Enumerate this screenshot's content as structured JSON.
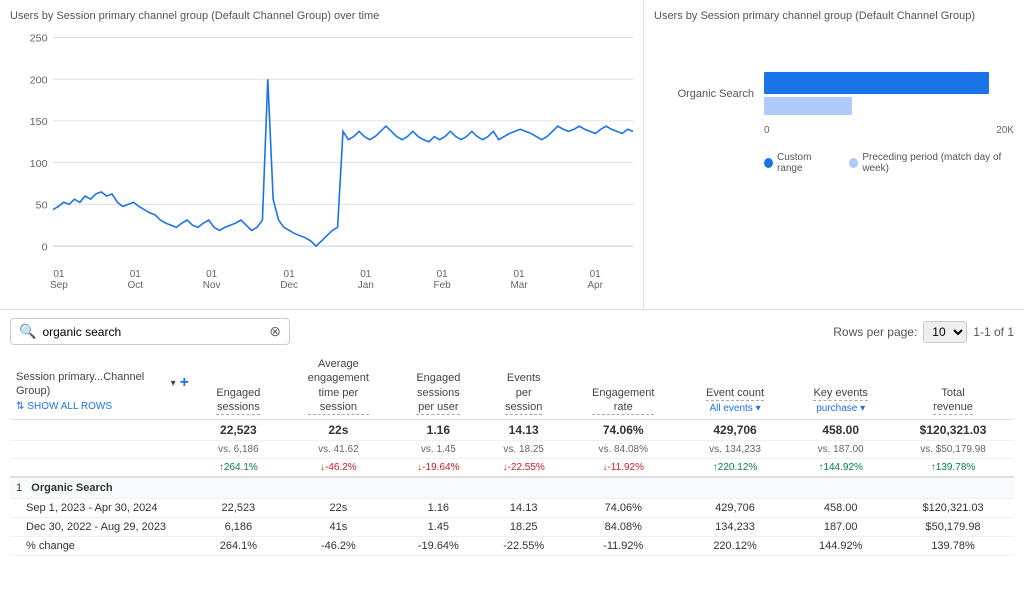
{
  "leftChart": {
    "title": "Users by Session primary channel group (Default Channel Group) over time",
    "xLabels": [
      "01\nSep",
      "01\nOct",
      "01\nNov",
      "01\nDec",
      "01\nJan",
      "01\nFeb",
      "01\nMar",
      "01\nApr"
    ],
    "yLabels": [
      "250",
      "200",
      "150",
      "100",
      "50",
      "0"
    ]
  },
  "rightChart": {
    "title": "Users by Session primary channel group (Default Channel Group)",
    "barLabel": "Organic Search",
    "xAxisMax": "20K",
    "xAxisStart": "0",
    "legend": {
      "custom": "Custom range",
      "preceding": "Preceding period (match day of week)"
    }
  },
  "search": {
    "placeholder": "organic search",
    "value": "organic search"
  },
  "pagination": {
    "rowsLabel": "Rows per page:",
    "rowsValue": "10",
    "range": "1-1 of 1"
  },
  "table": {
    "col1": "Session primary...Channel Group)",
    "col2": "Engaged\nsessions",
    "col3": "Average\nengagement\ntime per\nsession",
    "col4": "Engaged\nsessions\nper user",
    "col5": "Events\nper\nsession",
    "col6": "Engagement\nrate",
    "col7": "Event count\nAll events",
    "col8": "Key events\npurchase",
    "col9": "Total\nrevenue",
    "totals": {
      "engaged_sessions": "22,523",
      "avg_time": "22s",
      "engaged_per_user": "1.16",
      "events_per_session": "14.13",
      "engagement_rate": "74.06%",
      "event_count": "429,706",
      "key_events": "458.00",
      "total_revenue": "$120,321.03"
    },
    "vs": {
      "engaged_sessions": "vs. 6,186",
      "avg_time": "vs. 41.62",
      "engaged_per_user": "vs. 1.45",
      "events_per_session": "vs. 18.25",
      "engagement_rate": "vs. 84.08%",
      "event_count": "vs. 134,233",
      "key_events": "vs. 187.00",
      "total_revenue": "vs. $50,179.98"
    },
    "pct": {
      "engaged_sessions": "264.1%",
      "engaged_sessions_dir": "up",
      "avg_time": "-46.2%",
      "avg_time_dir": "down",
      "engaged_per_user": "-19.64%",
      "engaged_per_user_dir": "down",
      "events_per_session": "-22.55%",
      "events_per_session_dir": "down",
      "engagement_rate": "-11.92%",
      "engagement_rate_dir": "down",
      "event_count": "220.12%",
      "event_count_dir": "up",
      "key_events": "144.92%",
      "key_events_dir": "up",
      "total_revenue": "139.78%",
      "total_revenue_dir": "up"
    },
    "row1": {
      "number": "1",
      "name": "Organic Search",
      "date1": "Sep 1, 2023 - Apr 30, 2024",
      "date2": "Dec 30, 2022 - Aug 29, 2023",
      "date3": "% change",
      "r1": {
        "engaged_sessions": "22,523",
        "avg_time": "22s",
        "engaged_per_user": "1.16",
        "events_per_session": "14.13",
        "engagement_rate": "74.06%",
        "event_count": "429,706",
        "key_events": "458.00",
        "total_revenue": "$120,321.03"
      },
      "r2": {
        "engaged_sessions": "6,186",
        "avg_time": "41s",
        "engaged_per_user": "1.45",
        "events_per_session": "18.25",
        "engagement_rate": "84.08%",
        "event_count": "134,233",
        "key_events": "187.00",
        "total_revenue": "$50,179.98"
      },
      "r3": {
        "engaged_sessions": "264.1%",
        "avg_time": "-46.2%",
        "engaged_per_user": "-19.64%",
        "events_per_session": "-22.55%",
        "engagement_rate": "-11.92%",
        "event_count": "220.12%",
        "key_events": "144.92%",
        "total_revenue": "139.78%"
      }
    }
  }
}
